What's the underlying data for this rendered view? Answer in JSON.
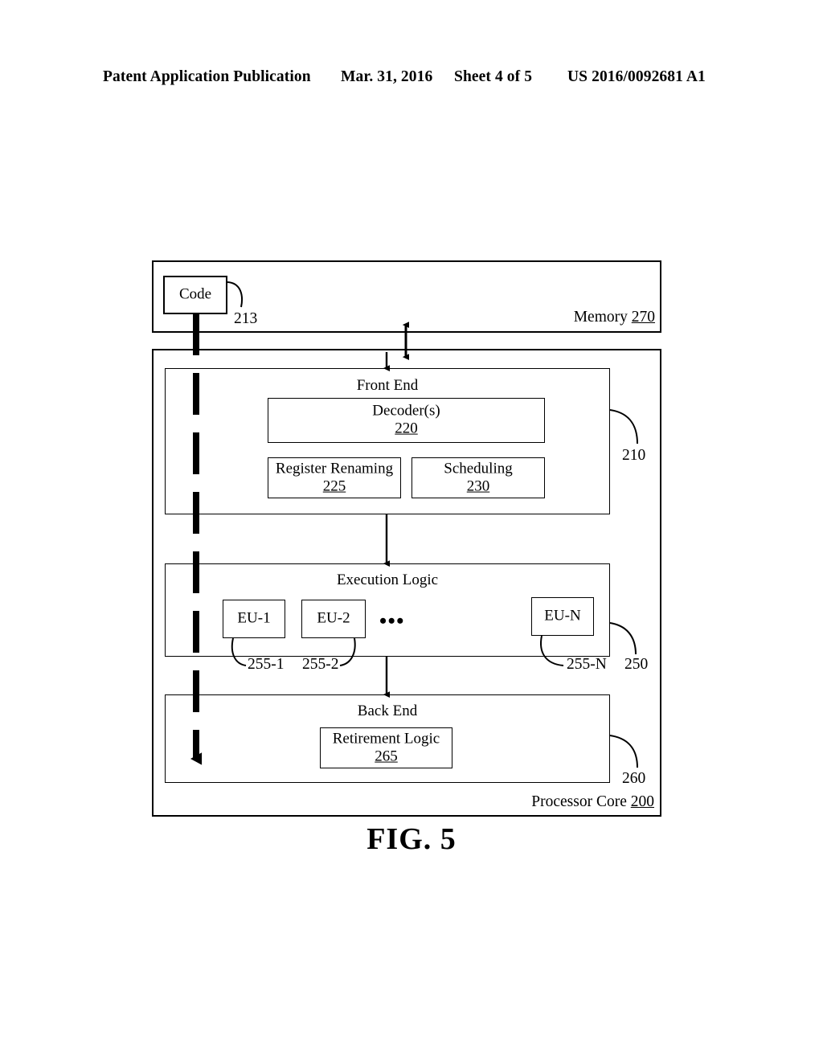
{
  "header": {
    "publication": "Patent Application Publication",
    "date": "Mar. 31, 2016",
    "sheet": "Sheet 4 of 5",
    "document_number": "US 2016/0092681 A1"
  },
  "figure": {
    "caption": "FIG. 5",
    "memory": {
      "label": "Memory",
      "ref": "270",
      "code_block": {
        "label": "Code",
        "ref": "213"
      }
    },
    "processor_core": {
      "label": "Processor Core",
      "ref": "200",
      "sections": [
        {
          "title": "Front End",
          "ref": "210",
          "blocks": [
            {
              "label": "Decoder(s)",
              "ref": "220"
            },
            {
              "label": "Register Renaming",
              "ref": "225"
            },
            {
              "label": "Scheduling",
              "ref": "230"
            }
          ]
        },
        {
          "title": "Execution Logic",
          "ref": "250",
          "blocks": [
            {
              "label": "EU-1",
              "ref": "255-1"
            },
            {
              "label": "EU-2",
              "ref": "255-2"
            },
            {
              "label": "EU-N",
              "ref": "255-N"
            }
          ],
          "ellipsis": "•••"
        },
        {
          "title": "Back End",
          "ref": "260",
          "blocks": [
            {
              "label": "Retirement Logic",
              "ref": "265"
            }
          ]
        }
      ]
    }
  },
  "colors": {
    "ink": "#000000",
    "paper": "#ffffff"
  }
}
